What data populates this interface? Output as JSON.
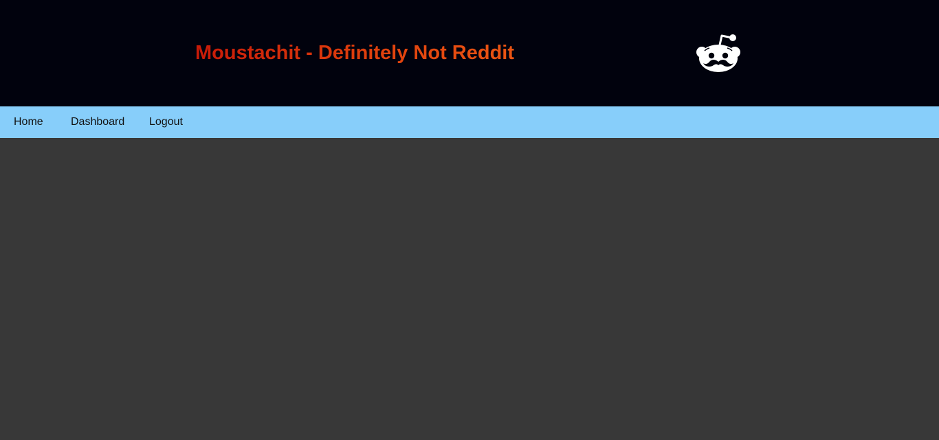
{
  "header": {
    "title": "Moustachit - Definitely Not Reddit",
    "logo_icon": "moustache-alien-logo-icon"
  },
  "nav": {
    "home": "Home",
    "dashboard": "Dashboard",
    "logout": "Logout"
  },
  "colors": {
    "header_bg": "#01020d",
    "title_start": "#c81a08",
    "title_end": "#ea5513",
    "nav_bg": "#87cefa",
    "body_bg": "#383838"
  }
}
